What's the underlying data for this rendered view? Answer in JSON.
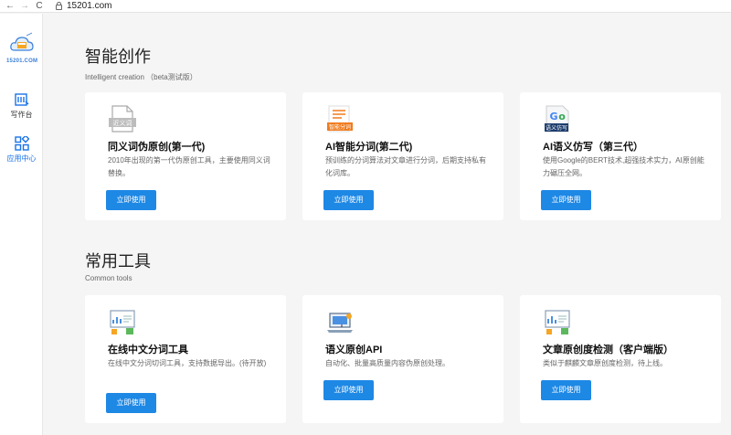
{
  "browser": {
    "url": "15201.com",
    "back": "←",
    "forward": "→",
    "reload": "C"
  },
  "sidebar": {
    "logo_text": "15201.COM",
    "items": [
      {
        "label": "写作台",
        "icon": "writing-desk-icon"
      },
      {
        "label": "应用中心",
        "icon": "app-center-icon"
      }
    ]
  },
  "sections": [
    {
      "title": "智能创作",
      "subtitle": "Intelligent creation （beta测试版）",
      "cards": [
        {
          "icon": "synonym-doc-icon",
          "icon_text": "近义词",
          "title": "同义词伪原创(第一代)",
          "desc": "2010年出现的第一代伪原创工具，主要使用同义词替换。",
          "button": "立即使用"
        },
        {
          "icon": "smart-segment-icon",
          "icon_text": "智能分词",
          "title": "AI智能分词(第二代)",
          "desc": "预训练的分词算法对文章进行分词，后期支持私有化词库。",
          "button": "立即使用"
        },
        {
          "icon": "google-rewrite-icon",
          "icon_text": "语义仿写",
          "title": "AI语义仿写（第三代）",
          "desc": "使用Google的BERT技术,超强技术实力，AI原创能力碾压全网。",
          "button": "立即使用"
        }
      ]
    },
    {
      "title": "常用工具",
      "subtitle": "Common tools",
      "cards": [
        {
          "icon": "monitor-chart-icon",
          "title": "在线中文分词工具",
          "desc": "在线中文分词切词工具，支持数据导出。(待开放)",
          "button": "立即使用"
        },
        {
          "icon": "laptop-api-icon",
          "title": "语义原创API",
          "desc": "自动化、批量高质量内容伪原创处理。",
          "button": "立即使用"
        },
        {
          "icon": "monitor-check-icon",
          "title": "文章原创度检测（客户端版）",
          "desc": "类似于麒麟文章原创度检测，待上线。",
          "button": "立即使用"
        }
      ]
    }
  ],
  "colors": {
    "accent": "#1e88e5",
    "orange": "#f07b1d",
    "page_bg": "#f5f5f5"
  }
}
